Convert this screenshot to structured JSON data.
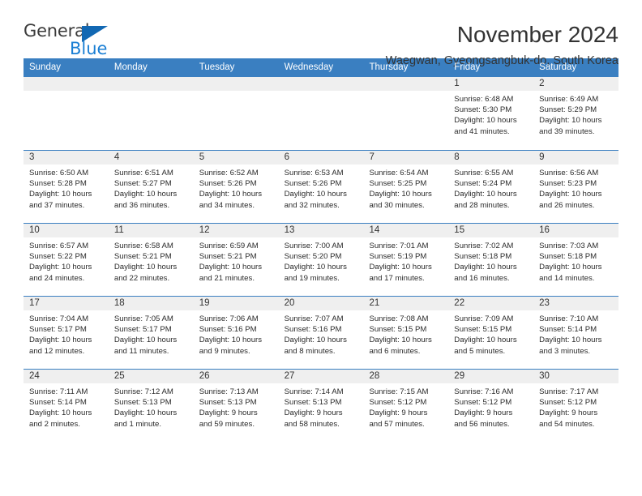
{
  "brand": {
    "name_part1": "General",
    "name_part2": "Blue",
    "triangle_color": "#1268b3",
    "blue_color": "#1a7fd4"
  },
  "header": {
    "title": "November 2024",
    "subtitle": "Waegwan, Gyeongsangbuk-do, South Korea",
    "accent_color": "#3a7fc1",
    "band_color": "#efefef"
  },
  "weekdays": [
    "Sunday",
    "Monday",
    "Tuesday",
    "Wednesday",
    "Thursday",
    "Friday",
    "Saturday"
  ],
  "weeks": [
    {
      "days": [
        {
          "date": "",
          "empty": true,
          "sunrise": "",
          "sunset": "",
          "daylight_l1": "",
          "daylight_l2": ""
        },
        {
          "date": "",
          "empty": true,
          "sunrise": "",
          "sunset": "",
          "daylight_l1": "",
          "daylight_l2": ""
        },
        {
          "date": "",
          "empty": true,
          "sunrise": "",
          "sunset": "",
          "daylight_l1": "",
          "daylight_l2": ""
        },
        {
          "date": "",
          "empty": true,
          "sunrise": "",
          "sunset": "",
          "daylight_l1": "",
          "daylight_l2": ""
        },
        {
          "date": "",
          "empty": true,
          "sunrise": "",
          "sunset": "",
          "daylight_l1": "",
          "daylight_l2": ""
        },
        {
          "date": "1",
          "empty": false,
          "sunrise": "Sunrise: 6:48 AM",
          "sunset": "Sunset: 5:30 PM",
          "daylight_l1": "Daylight: 10 hours",
          "daylight_l2": "and 41 minutes."
        },
        {
          "date": "2",
          "empty": false,
          "sunrise": "Sunrise: 6:49 AM",
          "sunset": "Sunset: 5:29 PM",
          "daylight_l1": "Daylight: 10 hours",
          "daylight_l2": "and 39 minutes."
        }
      ]
    },
    {
      "days": [
        {
          "date": "3",
          "empty": false,
          "sunrise": "Sunrise: 6:50 AM",
          "sunset": "Sunset: 5:28 PM",
          "daylight_l1": "Daylight: 10 hours",
          "daylight_l2": "and 37 minutes."
        },
        {
          "date": "4",
          "empty": false,
          "sunrise": "Sunrise: 6:51 AM",
          "sunset": "Sunset: 5:27 PM",
          "daylight_l1": "Daylight: 10 hours",
          "daylight_l2": "and 36 minutes."
        },
        {
          "date": "5",
          "empty": false,
          "sunrise": "Sunrise: 6:52 AM",
          "sunset": "Sunset: 5:26 PM",
          "daylight_l1": "Daylight: 10 hours",
          "daylight_l2": "and 34 minutes."
        },
        {
          "date": "6",
          "empty": false,
          "sunrise": "Sunrise: 6:53 AM",
          "sunset": "Sunset: 5:26 PM",
          "daylight_l1": "Daylight: 10 hours",
          "daylight_l2": "and 32 minutes."
        },
        {
          "date": "7",
          "empty": false,
          "sunrise": "Sunrise: 6:54 AM",
          "sunset": "Sunset: 5:25 PM",
          "daylight_l1": "Daylight: 10 hours",
          "daylight_l2": "and 30 minutes."
        },
        {
          "date": "8",
          "empty": false,
          "sunrise": "Sunrise: 6:55 AM",
          "sunset": "Sunset: 5:24 PM",
          "daylight_l1": "Daylight: 10 hours",
          "daylight_l2": "and 28 minutes."
        },
        {
          "date": "9",
          "empty": false,
          "sunrise": "Sunrise: 6:56 AM",
          "sunset": "Sunset: 5:23 PM",
          "daylight_l1": "Daylight: 10 hours",
          "daylight_l2": "and 26 minutes."
        }
      ]
    },
    {
      "days": [
        {
          "date": "10",
          "empty": false,
          "sunrise": "Sunrise: 6:57 AM",
          "sunset": "Sunset: 5:22 PM",
          "daylight_l1": "Daylight: 10 hours",
          "daylight_l2": "and 24 minutes."
        },
        {
          "date": "11",
          "empty": false,
          "sunrise": "Sunrise: 6:58 AM",
          "sunset": "Sunset: 5:21 PM",
          "daylight_l1": "Daylight: 10 hours",
          "daylight_l2": "and 22 minutes."
        },
        {
          "date": "12",
          "empty": false,
          "sunrise": "Sunrise: 6:59 AM",
          "sunset": "Sunset: 5:21 PM",
          "daylight_l1": "Daylight: 10 hours",
          "daylight_l2": "and 21 minutes."
        },
        {
          "date": "13",
          "empty": false,
          "sunrise": "Sunrise: 7:00 AM",
          "sunset": "Sunset: 5:20 PM",
          "daylight_l1": "Daylight: 10 hours",
          "daylight_l2": "and 19 minutes."
        },
        {
          "date": "14",
          "empty": false,
          "sunrise": "Sunrise: 7:01 AM",
          "sunset": "Sunset: 5:19 PM",
          "daylight_l1": "Daylight: 10 hours",
          "daylight_l2": "and 17 minutes."
        },
        {
          "date": "15",
          "empty": false,
          "sunrise": "Sunrise: 7:02 AM",
          "sunset": "Sunset: 5:18 PM",
          "daylight_l1": "Daylight: 10 hours",
          "daylight_l2": "and 16 minutes."
        },
        {
          "date": "16",
          "empty": false,
          "sunrise": "Sunrise: 7:03 AM",
          "sunset": "Sunset: 5:18 PM",
          "daylight_l1": "Daylight: 10 hours",
          "daylight_l2": "and 14 minutes."
        }
      ]
    },
    {
      "days": [
        {
          "date": "17",
          "empty": false,
          "sunrise": "Sunrise: 7:04 AM",
          "sunset": "Sunset: 5:17 PM",
          "daylight_l1": "Daylight: 10 hours",
          "daylight_l2": "and 12 minutes."
        },
        {
          "date": "18",
          "empty": false,
          "sunrise": "Sunrise: 7:05 AM",
          "sunset": "Sunset: 5:17 PM",
          "daylight_l1": "Daylight: 10 hours",
          "daylight_l2": "and 11 minutes."
        },
        {
          "date": "19",
          "empty": false,
          "sunrise": "Sunrise: 7:06 AM",
          "sunset": "Sunset: 5:16 PM",
          "daylight_l1": "Daylight: 10 hours",
          "daylight_l2": "and 9 minutes."
        },
        {
          "date": "20",
          "empty": false,
          "sunrise": "Sunrise: 7:07 AM",
          "sunset": "Sunset: 5:16 PM",
          "daylight_l1": "Daylight: 10 hours",
          "daylight_l2": "and 8 minutes."
        },
        {
          "date": "21",
          "empty": false,
          "sunrise": "Sunrise: 7:08 AM",
          "sunset": "Sunset: 5:15 PM",
          "daylight_l1": "Daylight: 10 hours",
          "daylight_l2": "and 6 minutes."
        },
        {
          "date": "22",
          "empty": false,
          "sunrise": "Sunrise: 7:09 AM",
          "sunset": "Sunset: 5:15 PM",
          "daylight_l1": "Daylight: 10 hours",
          "daylight_l2": "and 5 minutes."
        },
        {
          "date": "23",
          "empty": false,
          "sunrise": "Sunrise: 7:10 AM",
          "sunset": "Sunset: 5:14 PM",
          "daylight_l1": "Daylight: 10 hours",
          "daylight_l2": "and 3 minutes."
        }
      ]
    },
    {
      "days": [
        {
          "date": "24",
          "empty": false,
          "sunrise": "Sunrise: 7:11 AM",
          "sunset": "Sunset: 5:14 PM",
          "daylight_l1": "Daylight: 10 hours",
          "daylight_l2": "and 2 minutes."
        },
        {
          "date": "25",
          "empty": false,
          "sunrise": "Sunrise: 7:12 AM",
          "sunset": "Sunset: 5:13 PM",
          "daylight_l1": "Daylight: 10 hours",
          "daylight_l2": "and 1 minute."
        },
        {
          "date": "26",
          "empty": false,
          "sunrise": "Sunrise: 7:13 AM",
          "sunset": "Sunset: 5:13 PM",
          "daylight_l1": "Daylight: 9 hours",
          "daylight_l2": "and 59 minutes."
        },
        {
          "date": "27",
          "empty": false,
          "sunrise": "Sunrise: 7:14 AM",
          "sunset": "Sunset: 5:13 PM",
          "daylight_l1": "Daylight: 9 hours",
          "daylight_l2": "and 58 minutes."
        },
        {
          "date": "28",
          "empty": false,
          "sunrise": "Sunrise: 7:15 AM",
          "sunset": "Sunset: 5:12 PM",
          "daylight_l1": "Daylight: 9 hours",
          "daylight_l2": "and 57 minutes."
        },
        {
          "date": "29",
          "empty": false,
          "sunrise": "Sunrise: 7:16 AM",
          "sunset": "Sunset: 5:12 PM",
          "daylight_l1": "Daylight: 9 hours",
          "daylight_l2": "and 56 minutes."
        },
        {
          "date": "30",
          "empty": false,
          "sunrise": "Sunrise: 7:17 AM",
          "sunset": "Sunset: 5:12 PM",
          "daylight_l1": "Daylight: 9 hours",
          "daylight_l2": "and 54 minutes."
        }
      ]
    }
  ]
}
